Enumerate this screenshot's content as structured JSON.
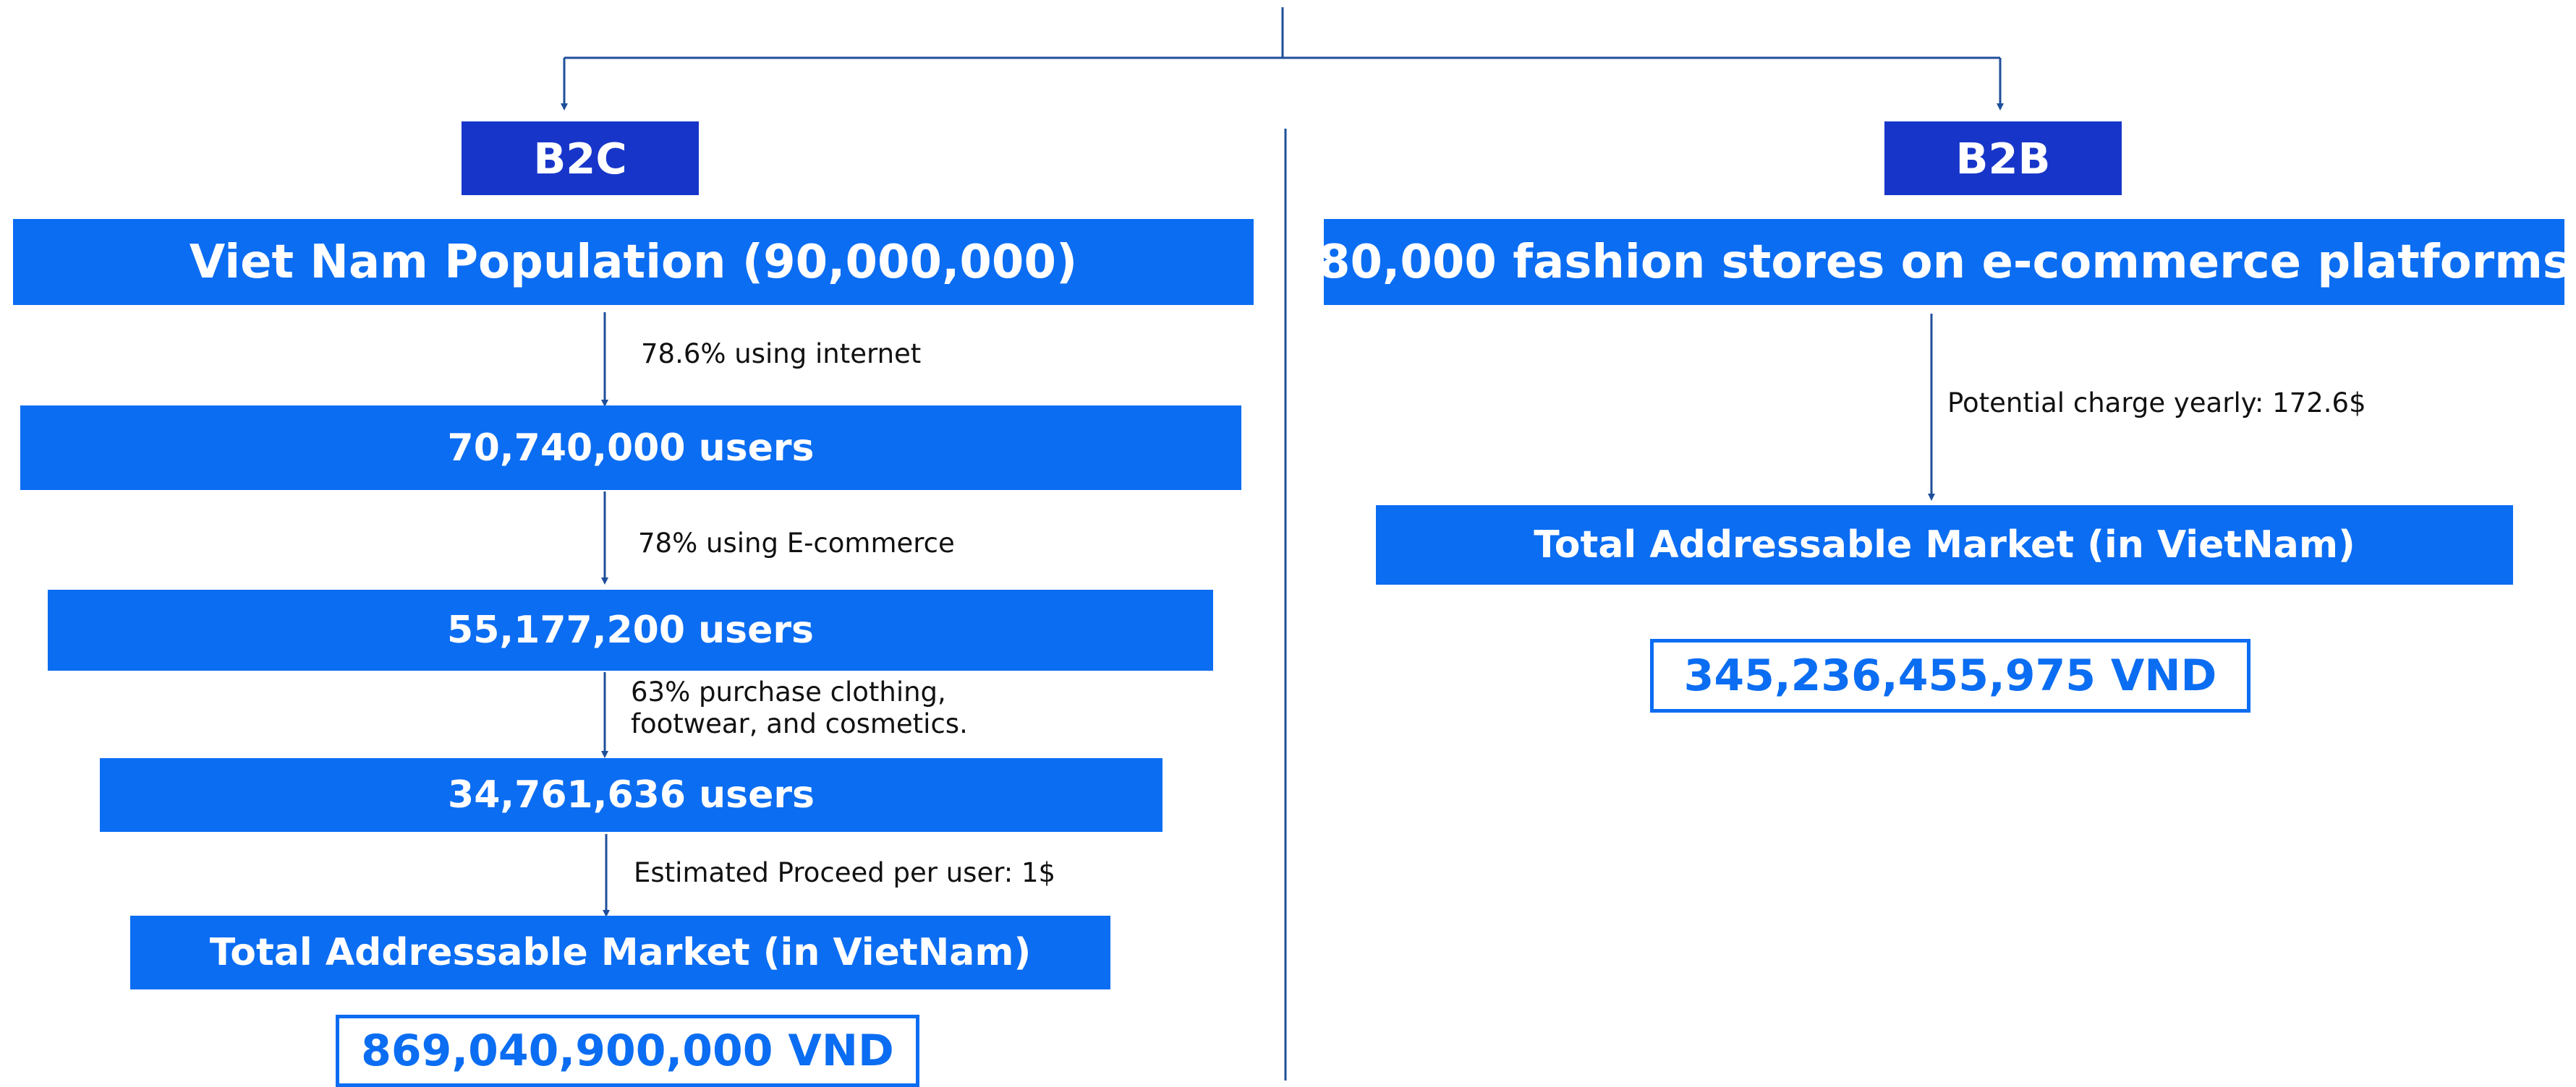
{
  "b2c": {
    "tag": "B2C",
    "stages": [
      "Viet Nam Population (90,000,000)",
      "70,740,000 users",
      "55,177,200 users",
      "34,761,636 users",
      "Total Addressable Market (in VietNam)"
    ],
    "notes": [
      "78.6% using internet",
      "78% using E-commerce",
      "63% purchase clothing,",
      "footwear, and cosmetics.",
      "Estimated Proceed per user: 1$"
    ],
    "result": "869,040,900,000 VND"
  },
  "b2b": {
    "tag": "B2B",
    "stages": [
      "80,000 fashion stores on e-commerce platforms",
      "Total Addressable Market (in VietNam)"
    ],
    "notes": [
      "Potential charge yearly: 172.6$"
    ],
    "result": "345,236,455,975 VND"
  },
  "colors": {
    "tag": "#1736c9",
    "stage": "#0b6df2",
    "line": "#1f4f9a"
  }
}
